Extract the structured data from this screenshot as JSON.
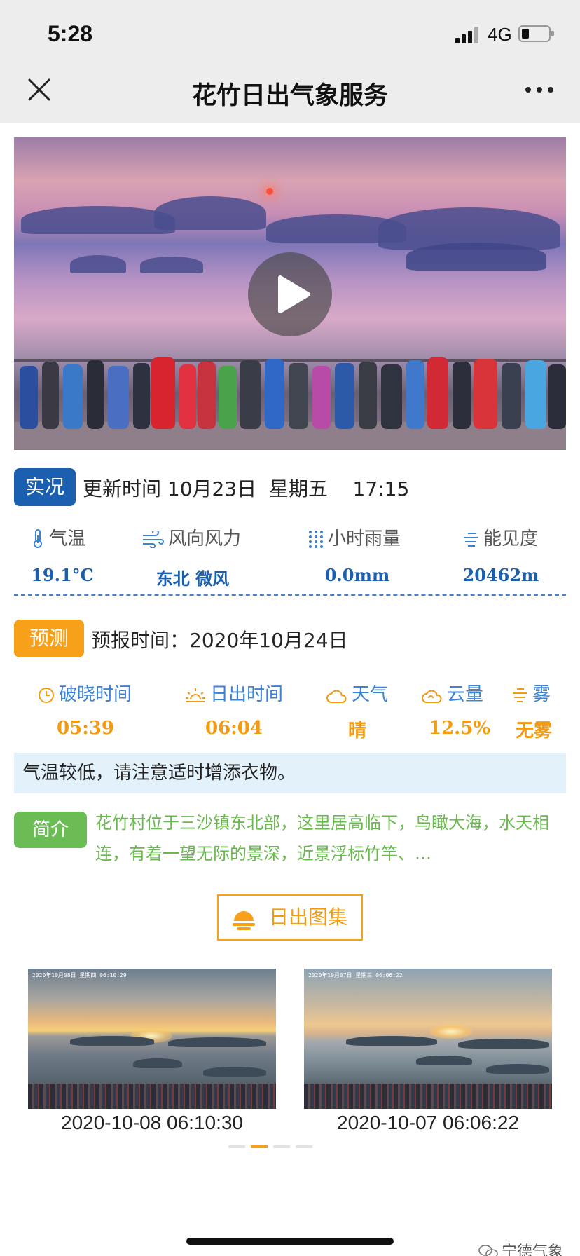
{
  "status_bar": {
    "time": "5:28",
    "network": "4G"
  },
  "nav": {
    "title": "花竹日出气象服务"
  },
  "live": {
    "tag": "实况",
    "update_line": "更新时间 10月23日  星期五    17:15",
    "metrics": [
      {
        "icon": "thermometer-icon",
        "label": "气温",
        "value": "19.1°C"
      },
      {
        "icon": "wind-icon",
        "label": "风向风力",
        "value": "东北 微风"
      },
      {
        "icon": "rain-icon",
        "label": "小时雨量",
        "value": "0.0mm"
      },
      {
        "icon": "visibility-icon",
        "label": "能见度",
        "value": "20462m"
      }
    ]
  },
  "forecast": {
    "tag": "预测",
    "time_line": "预报时间：2020年10月24日",
    "items": [
      {
        "icon": "clock-icon",
        "label": "破晓时间",
        "value": "05:39"
      },
      {
        "icon": "sunrise-icon",
        "label": "日出时间",
        "value": "06:04"
      },
      {
        "icon": "cloud-icon",
        "label": "天气",
        "value": "晴"
      },
      {
        "icon": "cloud-amount-icon",
        "label": "云量",
        "value": "12.5%"
      },
      {
        "icon": "fog-icon",
        "label": "雾",
        "value": "无雾"
      }
    ],
    "advice": "气温较低，请注意适时增添衣物。"
  },
  "intro": {
    "tag": "简介",
    "text": "花竹村位于三沙镇东北部，这里居高临下，鸟瞰大海，水天相连，有着一望无际的景深，近景浮标竹竿、…"
  },
  "gallery": {
    "button_label": "日出图集",
    "photos": [
      {
        "stamp": "2020年10月08日 星期四 06:10:29",
        "caption": "2020-10-08 06:10:30"
      },
      {
        "stamp": "2020年10月07日 星期三 06:06:22",
        "caption": "2020-10-07 06:06:22"
      }
    ],
    "pager_active": 2,
    "pager_total": 4
  },
  "watermark": "宁德气象",
  "colors": {
    "live_blue": "#1b5fb0",
    "forecast_orange": "#f7a11a",
    "intro_green": "#6cbc56",
    "label_blue": "#3b83d6"
  }
}
